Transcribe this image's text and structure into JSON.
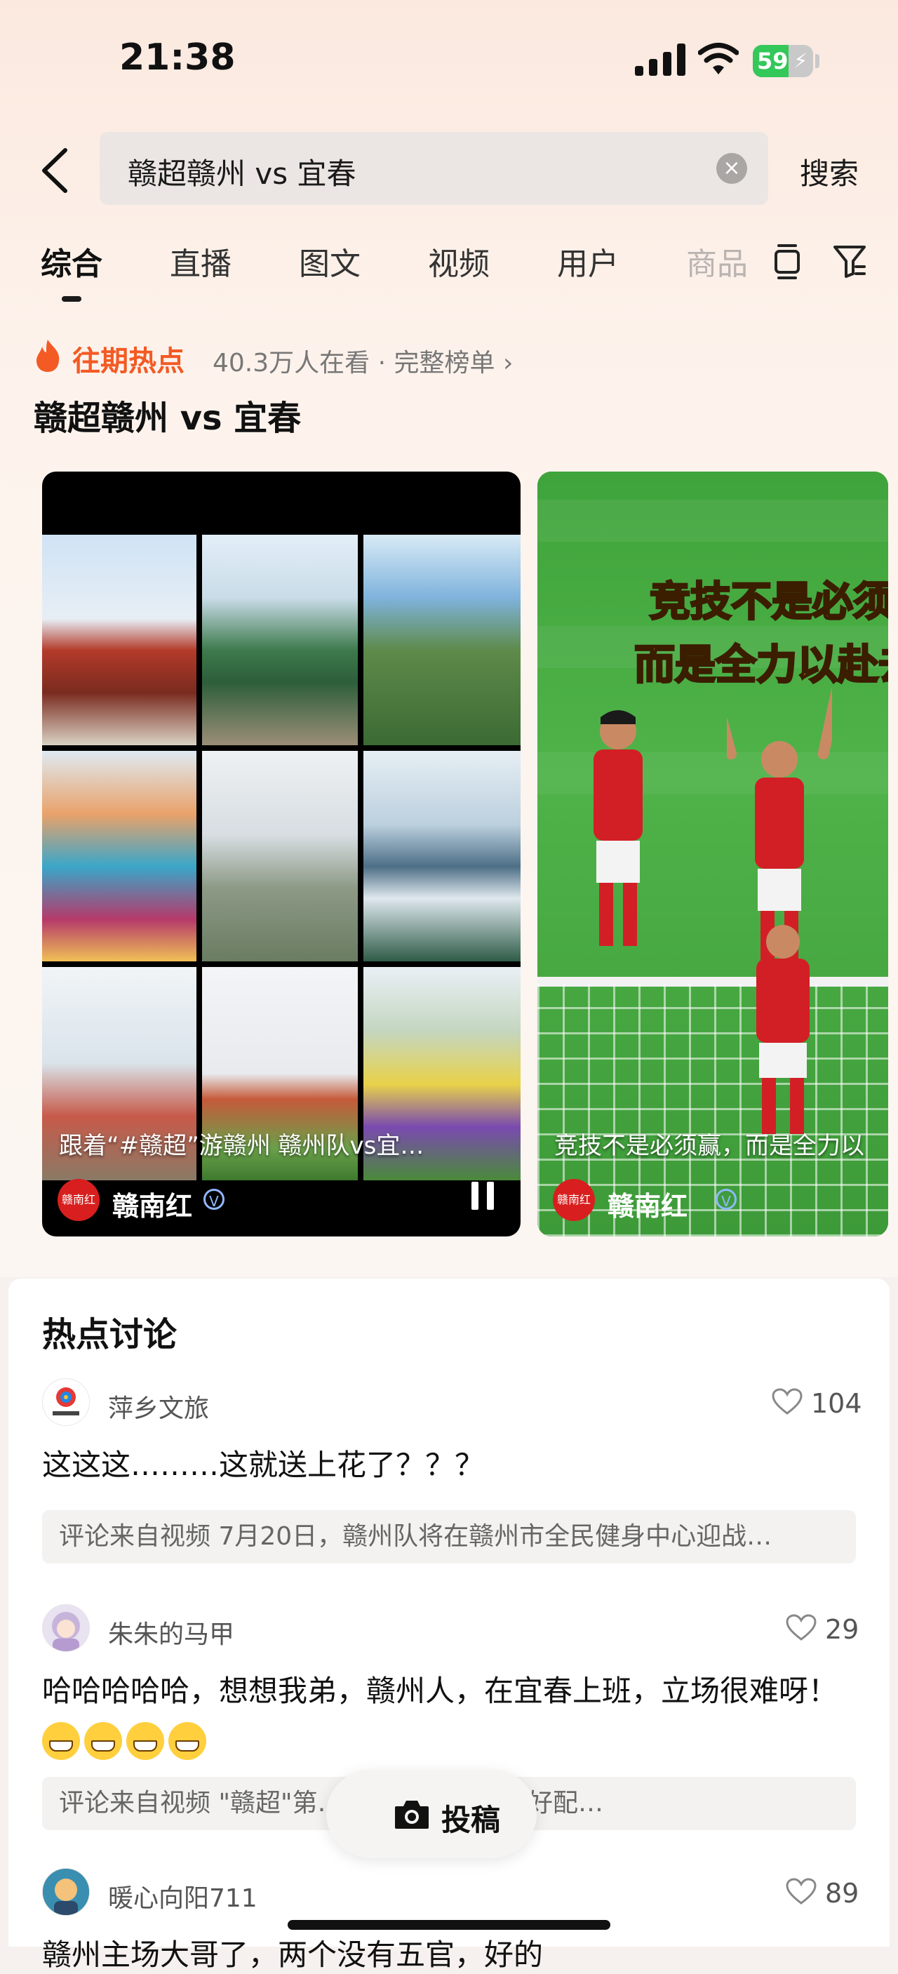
{
  "status_bar": {
    "time": "21:38",
    "battery": "59",
    "battery_level": 0.59
  },
  "search": {
    "query": "赣超赣州 vs 宜春",
    "button": "搜索"
  },
  "tabs": [
    "综合",
    "直播",
    "图文",
    "视频",
    "用户",
    "商品"
  ],
  "hot": {
    "title": "往期热点",
    "meta": "40.3万人在看 · 完整榜单",
    "topic": "赣超赣州 vs 宜春"
  },
  "videos": [
    {
      "caption": "跟着“#赣超”游赣州 赣州队vs宜…",
      "author": "赣南红",
      "logo": "赣南红"
    },
    {
      "caption": "竞技不是必须赢，而是全力以",
      "author": "赣南红",
      "logo": "赣南红",
      "overlay_line1": "竞技不是必须赢",
      "overlay_line2": "而是全力以赴去"
    }
  ],
  "discussion": {
    "title": "热点讨论",
    "comments": [
      {
        "user": "萍乡文旅",
        "likes": "104",
        "text": "这这这………这就送上花了？？？",
        "source": "评论来自视频 7月20日，赣州队将在赣州市全民健身中心迎战…"
      },
      {
        "user": "朱朱的马甲",
        "likes": "29",
        "text": "哈哈哈哈哈，想想我弟，赣州人，在宜春上班，立场很难呀！",
        "source": "评论来自视频 \"赣超\"第…  赣州，吃扎粉最好配…"
      },
      {
        "user": "暖心向阳711",
        "likes": "89",
        "text": "赣州主场大哥了，两个没有五官，好的"
      }
    ]
  },
  "post_button": "投稿",
  "colors": {
    "accent": "#f35a24",
    "battery": "#34c759"
  }
}
